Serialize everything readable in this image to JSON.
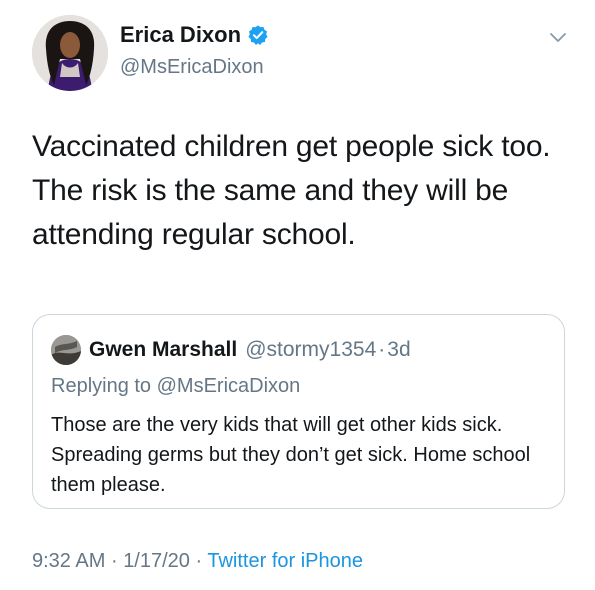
{
  "tweet": {
    "author": {
      "display_name": "Erica Dixon",
      "handle": "@MsEricaDixon",
      "verified": true
    },
    "text": "Vaccinated children get people sick too. The risk is the same and they will be attending regular school.",
    "timestamp_time": "9:32 AM",
    "timestamp_date": "1/17/20",
    "separator": "·",
    "source": "Twitter for iPhone"
  },
  "quoted_tweet": {
    "author": {
      "display_name": "Gwen Marshall",
      "handle": "@stormy1354"
    },
    "separator": "·",
    "age": "3d",
    "replying_to_prefix": "Replying to",
    "replying_to_handle": "@MsEricaDixon",
    "text": "Those are the very kids that will get other kids sick. Spreading germs but they don’t get sick. Home school them please."
  },
  "colors": {
    "text_primary": "#14171a",
    "text_secondary": "#657786",
    "link": "#1b95e0",
    "verified_badge": "#1da1f2",
    "border": "#ccd6dd"
  },
  "icons": {
    "verified": "verified-badge-icon",
    "caret": "chevron-down-icon"
  }
}
